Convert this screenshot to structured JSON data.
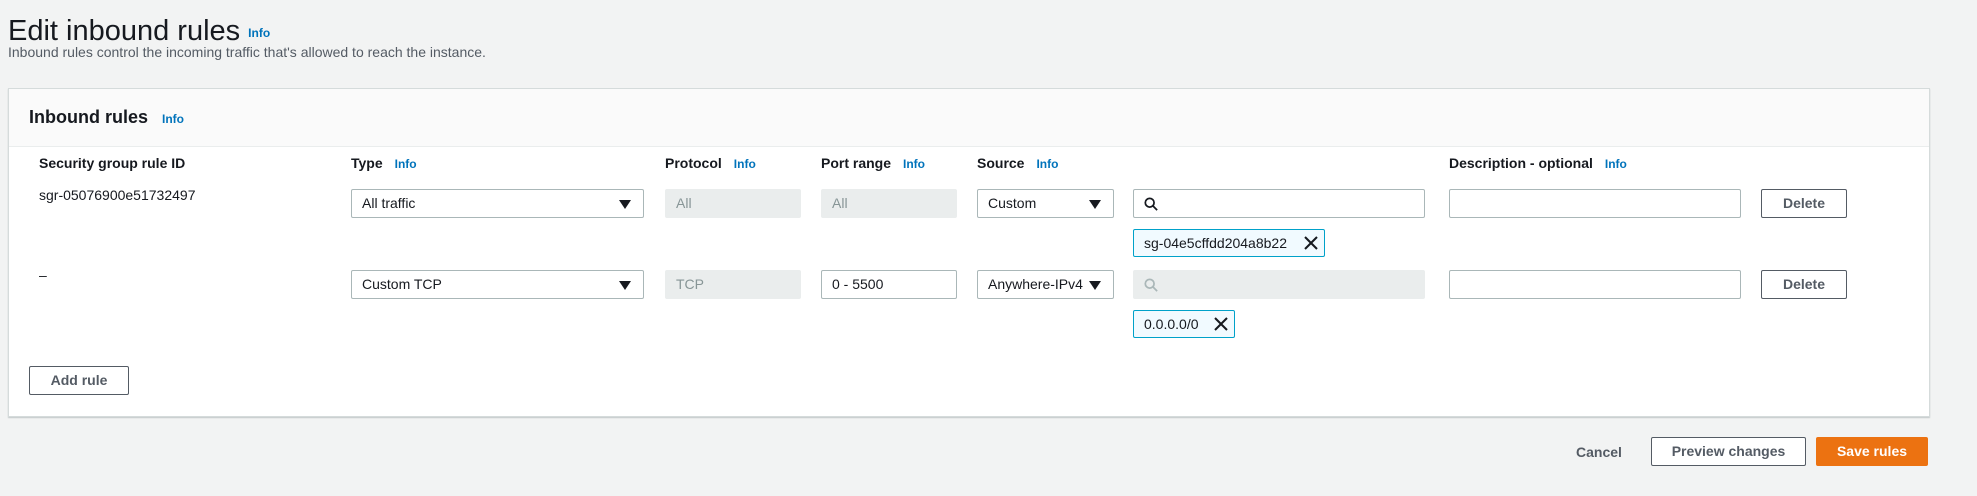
{
  "header": {
    "title": "Edit inbound rules",
    "info": "Info",
    "description": "Inbound rules control the incoming traffic that's allowed to reach the instance."
  },
  "panel": {
    "title": "Inbound rules",
    "info": "Info",
    "columns": {
      "rule_id": "Security group rule ID",
      "type": "Type",
      "protocol": "Protocol",
      "port_range": "Port range",
      "source": "Source",
      "description": "Description - optional",
      "info": "Info"
    },
    "rows": [
      {
        "rule_id": "sgr-05076900e51732497",
        "type": "All traffic",
        "protocol": "All",
        "port_range": "All",
        "source": "Custom",
        "source_search": "",
        "token": "sg-04e5cffdd204a8b22",
        "description": "",
        "delete": "Delete"
      },
      {
        "rule_id": "–",
        "type": "Custom TCP",
        "protocol": "TCP",
        "port_range": "0 - 5500",
        "source": "Anywhere-IPv4",
        "source_search": "",
        "token": "0.0.0.0/0",
        "description": "",
        "delete": "Delete"
      }
    ],
    "add_rule": "Add rule"
  },
  "footer": {
    "cancel": "Cancel",
    "preview": "Preview changes",
    "save": "Save rules"
  },
  "colors": {
    "primary": "#ec7211",
    "link": "#0073bb",
    "token_border": "#00a1c9"
  }
}
